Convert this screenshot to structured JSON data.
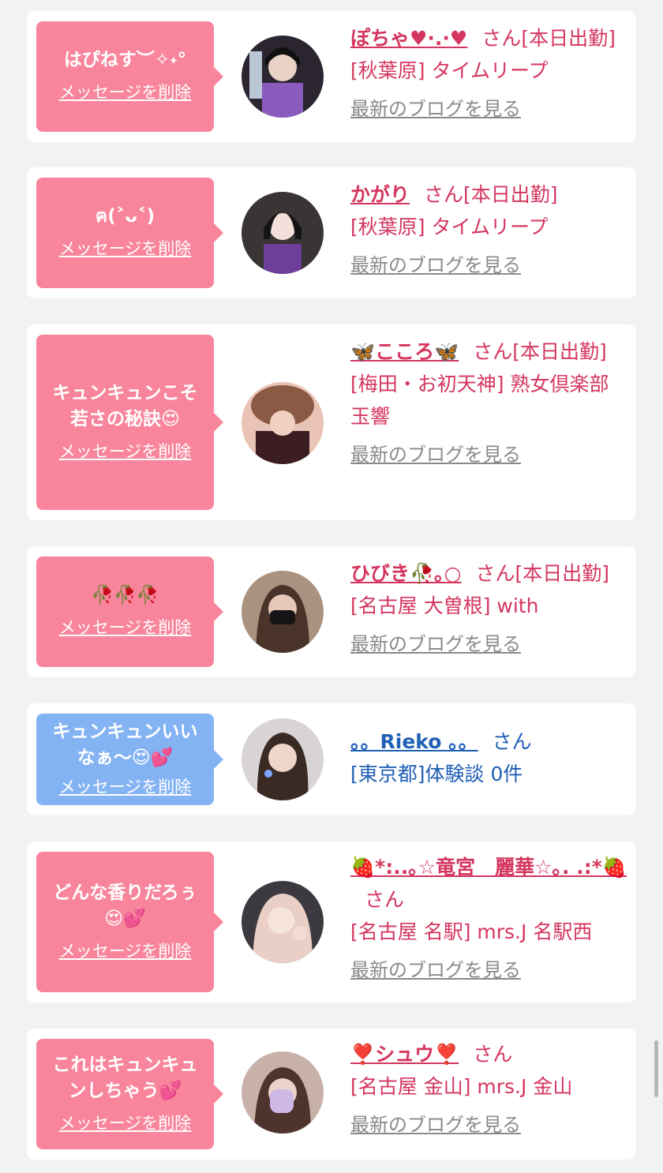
{
  "delete_label": "メッセージを削除",
  "blog_label": "最新のブログを見る",
  "colors": {
    "pink_bubble": "#f8859b",
    "blue_bubble": "#84b3f4",
    "name_pink": "#d4365f",
    "name_blue": "#1f5fb5",
    "link_gray": "#8a8a8a"
  },
  "cards": [
    {
      "message": "はぴねす︶✧˖°",
      "name": "ぽちゃ♥·.·♥",
      "san": "さん",
      "status": "[本日出勤]",
      "shop": "[秋葉原] タイムリープ",
      "has_blog": true
    },
    {
      "message": "ฅ(˃ᴗ˂)",
      "name": "かがり",
      "san": "さん",
      "status": "[本日出勤]",
      "shop": "[秋葉原] タイムリープ",
      "has_blog": true
    },
    {
      "message": "キュンキュンこそ\n若さの秘訣😍",
      "name": "🦋こころ🦋",
      "san": "さん",
      "status": "[本日出勤]",
      "shop": "[梅田・お初天神] 熟女倶楽部 玉響",
      "has_blog": true
    },
    {
      "message": "🥀🥀🥀",
      "name": "ひびき🥀｡○",
      "san": "さん",
      "status": "[本日出勤]",
      "shop": "[名古屋 大曽根] with",
      "has_blog": true
    },
    {
      "message": "キュンキュンいい\nなぁ〜😍💕",
      "name": "。。Rieko 。。",
      "san": "さん",
      "status": "",
      "shop": "[東京都]体験談 0件",
      "has_blog": false
    },
    {
      "message": "どんな香りだろぅ\n😍💕",
      "name": "🍓*:..｡☆竜宮　麗華☆｡. .:*🍓",
      "san": "さん",
      "status": "",
      "shop": "[名古屋 名駅] mrs.J 名駅西",
      "has_blog": true
    },
    {
      "message": "これはキュンキュ\nンしちゃう💕",
      "name": "❣️シュウ❣️",
      "san": "さん",
      "status": "",
      "shop": "[名古屋 金山] mrs.J 金山",
      "has_blog": true
    }
  ]
}
